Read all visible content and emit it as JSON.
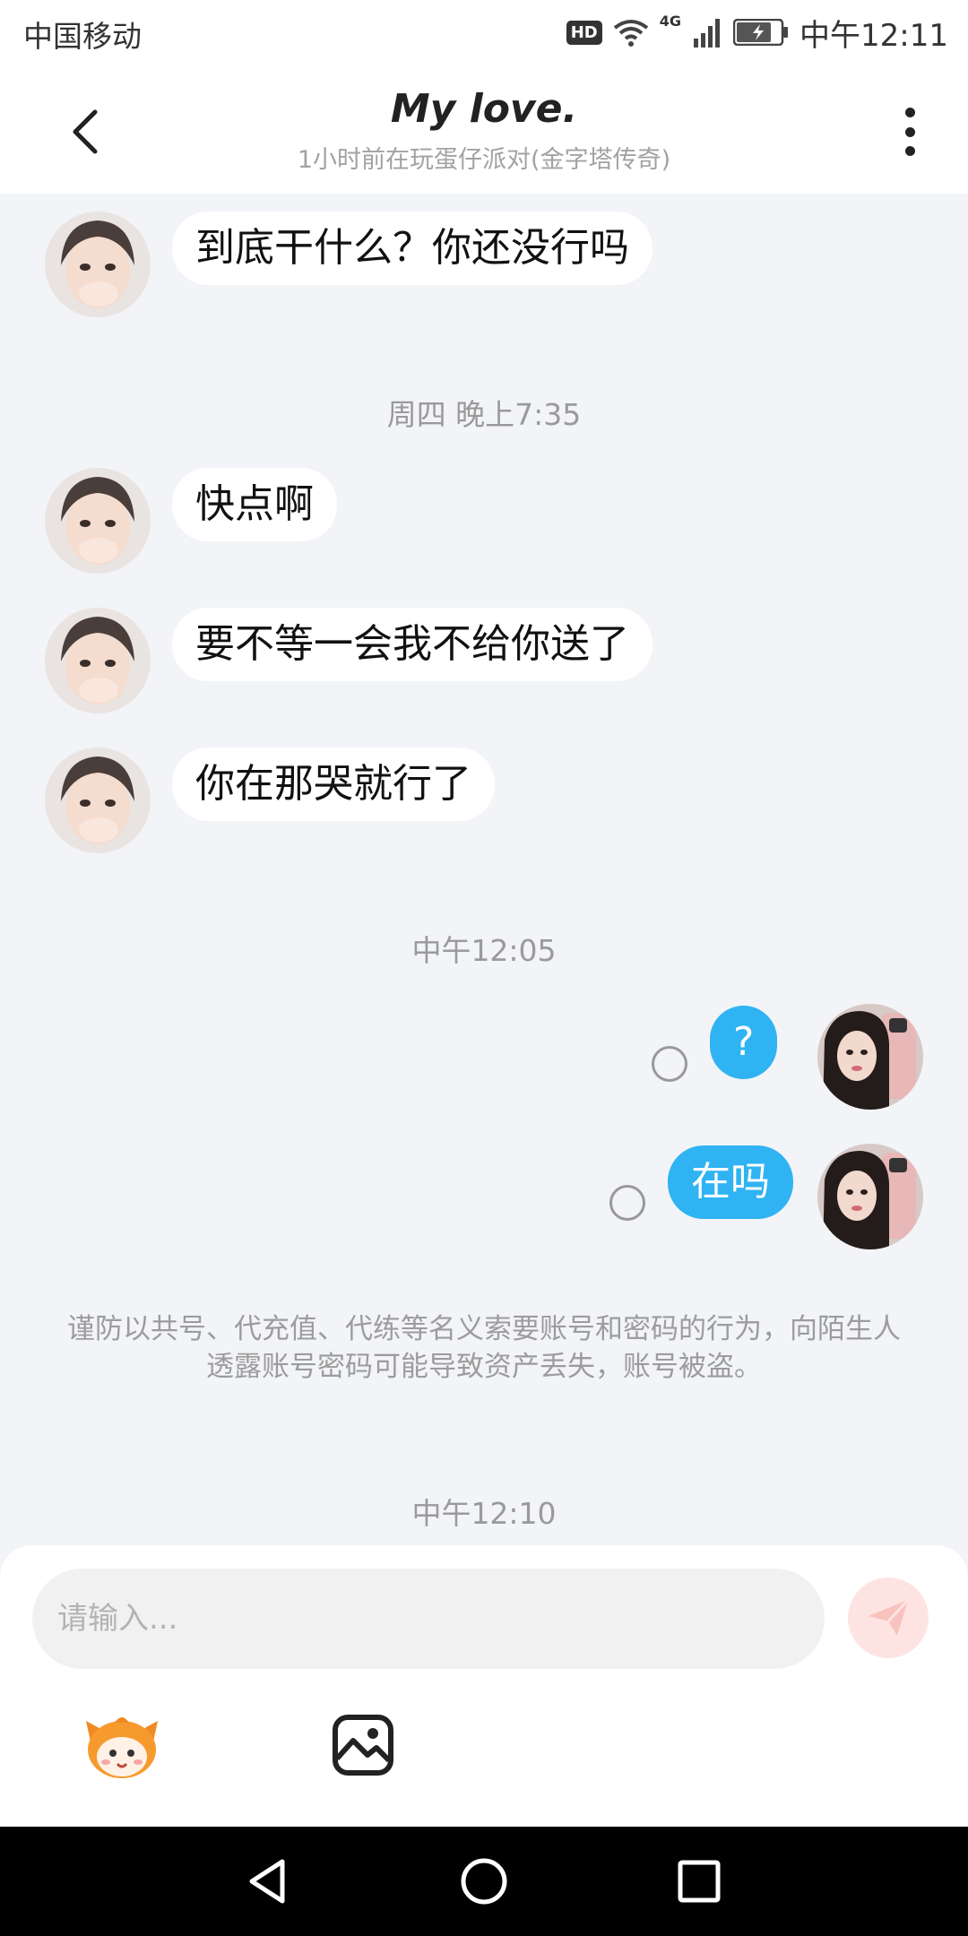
{
  "status_bar": {
    "carrier": "中国移动",
    "hd": "HD",
    "network": "4G",
    "time": "中午12:11"
  },
  "header": {
    "title": "My love.",
    "subtitle": "1小时前在玩蛋仔派对(金字塔传奇)"
  },
  "messages": {
    "m1": "到底干什么？你还没行吗",
    "t1": "周四 晚上7:35",
    "m2": "快点啊",
    "m3": "要不等一会我不给你送了",
    "m4": "你在那哭就行了",
    "t2": "中午12:05",
    "m5": "?",
    "m6": "在吗",
    "notice": "谨防以共号、代充值、代练等名义索要账号和密码的行为，向陌生人透露账号密码可能导致资产丢失，账号被盗。",
    "t3": "中午12:10"
  },
  "input": {
    "placeholder": "请输入..."
  },
  "colors": {
    "accent": "#2fb3f2",
    "background": "#f2f4f7",
    "send_button": "#fde4e2"
  }
}
